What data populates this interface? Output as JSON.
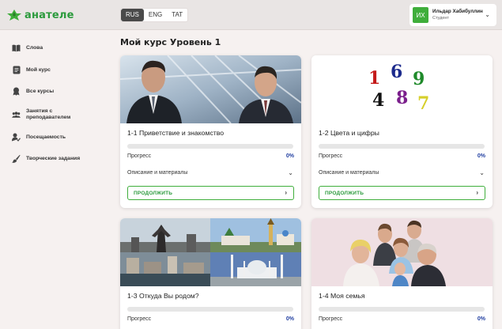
{
  "header": {
    "logo_text": "анателе",
    "languages": [
      {
        "label": "RUS",
        "active": true
      },
      {
        "label": "ENG",
        "active": false
      },
      {
        "label": "TAT",
        "active": false
      }
    ],
    "user": {
      "initials": "ИХ",
      "name": "Ильдар Хабибуллин",
      "role": "Студент"
    }
  },
  "sidebar": {
    "items": [
      {
        "label": "Слова",
        "icon": "book-icon"
      },
      {
        "label": "Мой курс",
        "icon": "course-icon"
      },
      {
        "label": "Все курсы",
        "icon": "courses-icon"
      },
      {
        "label": "Занятия с\nпреподавателем",
        "icon": "group-icon"
      },
      {
        "label": "Посещаемость",
        "icon": "attendance-icon"
      },
      {
        "label": "Творческие задания",
        "icon": "brush-icon"
      }
    ]
  },
  "main": {
    "title": "Мой курс Уровень 1",
    "cards": [
      {
        "title": "1-1 Приветствие и знакомство",
        "progress_label": "Прогресс",
        "progress_pct": "0%",
        "progress_value": 0,
        "desc_label": "Описание и материалы",
        "button_label": "ПРОДОЛЖИТЬ"
      },
      {
        "title": "1-2 Цвета и цифры",
        "progress_label": "Прогресс",
        "progress_pct": "0%",
        "progress_value": 0,
        "desc_label": "Описание и материалы",
        "button_label": "ПРОДОЛЖИТЬ",
        "numbers": [
          "1",
          "6",
          "9",
          "4",
          "8",
          "7"
        ]
      },
      {
        "title": "1-3 Откуда Вы родом?",
        "progress_label": "Прогресс",
        "progress_pct": "0%",
        "progress_value": 0
      },
      {
        "title": "1-4 Моя семья",
        "progress_label": "Прогресс",
        "progress_pct": "0%",
        "progress_value": 0
      }
    ]
  },
  "colors": {
    "brand_green": "#3fae3b",
    "accent_blue": "#1f3da0",
    "background": "#f6f1f0"
  }
}
